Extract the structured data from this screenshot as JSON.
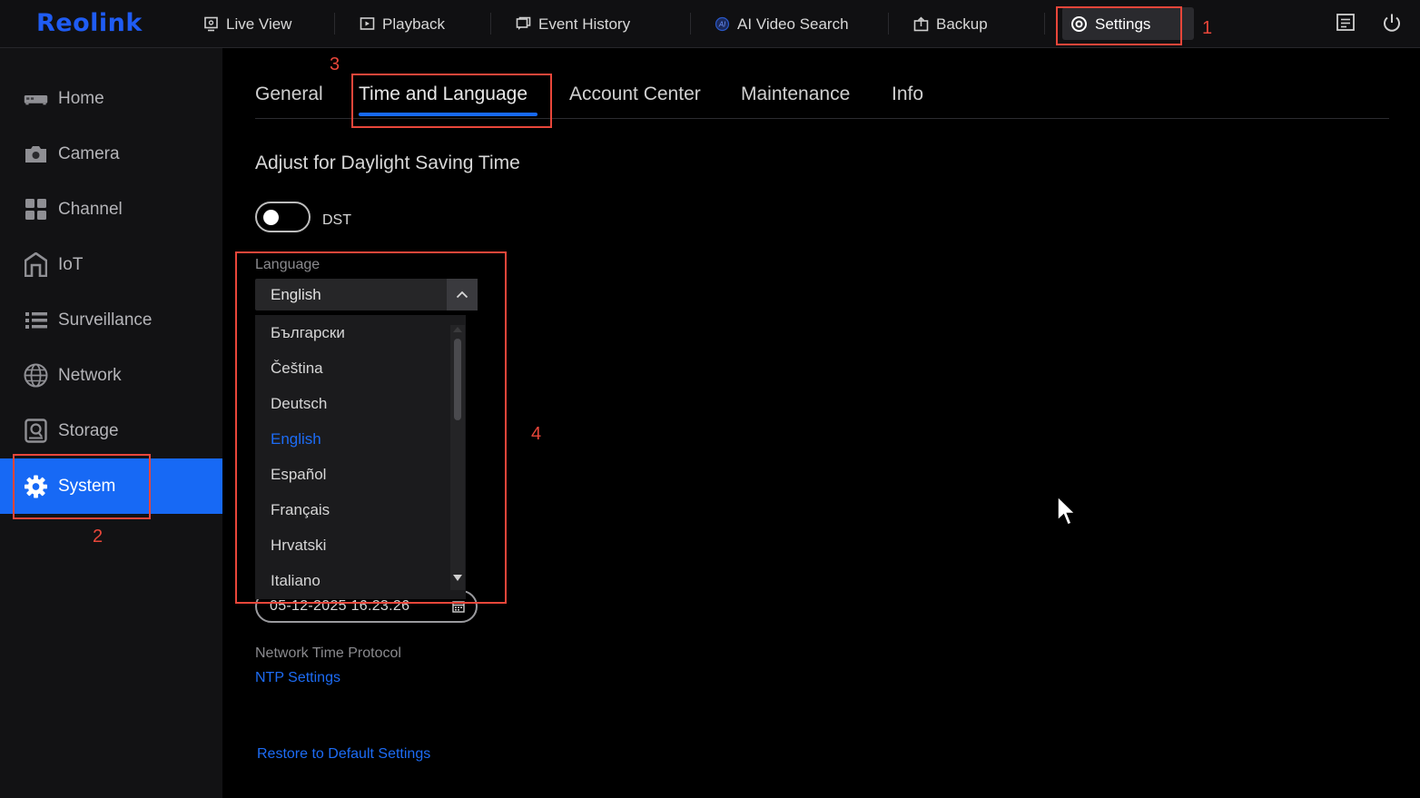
{
  "app": {
    "logo": "Reolink",
    "nav": [
      {
        "label": "Live View",
        "icon": "monitor-icon"
      },
      {
        "label": "Playback",
        "icon": "playback-icon"
      },
      {
        "label": "Event History",
        "icon": "event-history-icon"
      },
      {
        "label": "AI Video Search",
        "icon": "ai-search-icon"
      },
      {
        "label": "Backup",
        "icon": "backup-icon"
      },
      {
        "label": "Settings",
        "icon": "settings-gear-icon",
        "active": true
      }
    ],
    "top_right_icons": [
      "notes-icon",
      "power-icon"
    ]
  },
  "sidebar": {
    "items": [
      {
        "label": "Home",
        "icon": "home-icon"
      },
      {
        "label": "Camera",
        "icon": "camera-icon"
      },
      {
        "label": "Channel",
        "icon": "channel-icon"
      },
      {
        "label": "IoT",
        "icon": "iot-icon"
      },
      {
        "label": "Surveillance",
        "icon": "surveillance-list-icon"
      },
      {
        "label": "Network",
        "icon": "globe-icon"
      },
      {
        "label": "Storage",
        "icon": "storage-icon"
      },
      {
        "label": "System",
        "icon": "system-gear-icon",
        "active": true
      }
    ]
  },
  "tabs": [
    {
      "label": "General"
    },
    {
      "label": "Time and Language",
      "active": true
    },
    {
      "label": "Account Center"
    },
    {
      "label": "Maintenance"
    },
    {
      "label": "Info"
    }
  ],
  "dst": {
    "title": "Adjust for Daylight Saving Time",
    "label": "DST",
    "enabled": false
  },
  "language": {
    "label": "Language",
    "selected": "English",
    "options": [
      "Български",
      "Čeština",
      "Deutsch",
      "English",
      "Español",
      "Français",
      "Hrvatski",
      "Italiano"
    ]
  },
  "datetime": {
    "value": "05-12-2025 16:23:26"
  },
  "ntp": {
    "label": "Network Time Protocol",
    "link": "NTP Settings"
  },
  "restore_link": "Restore to Default Settings",
  "annotations": [
    "1",
    "2",
    "3",
    "4"
  ],
  "colors": {
    "accent": "#1769f5",
    "annotation": "#e8463a",
    "background": "#000000",
    "sidebar": "#121214"
  }
}
